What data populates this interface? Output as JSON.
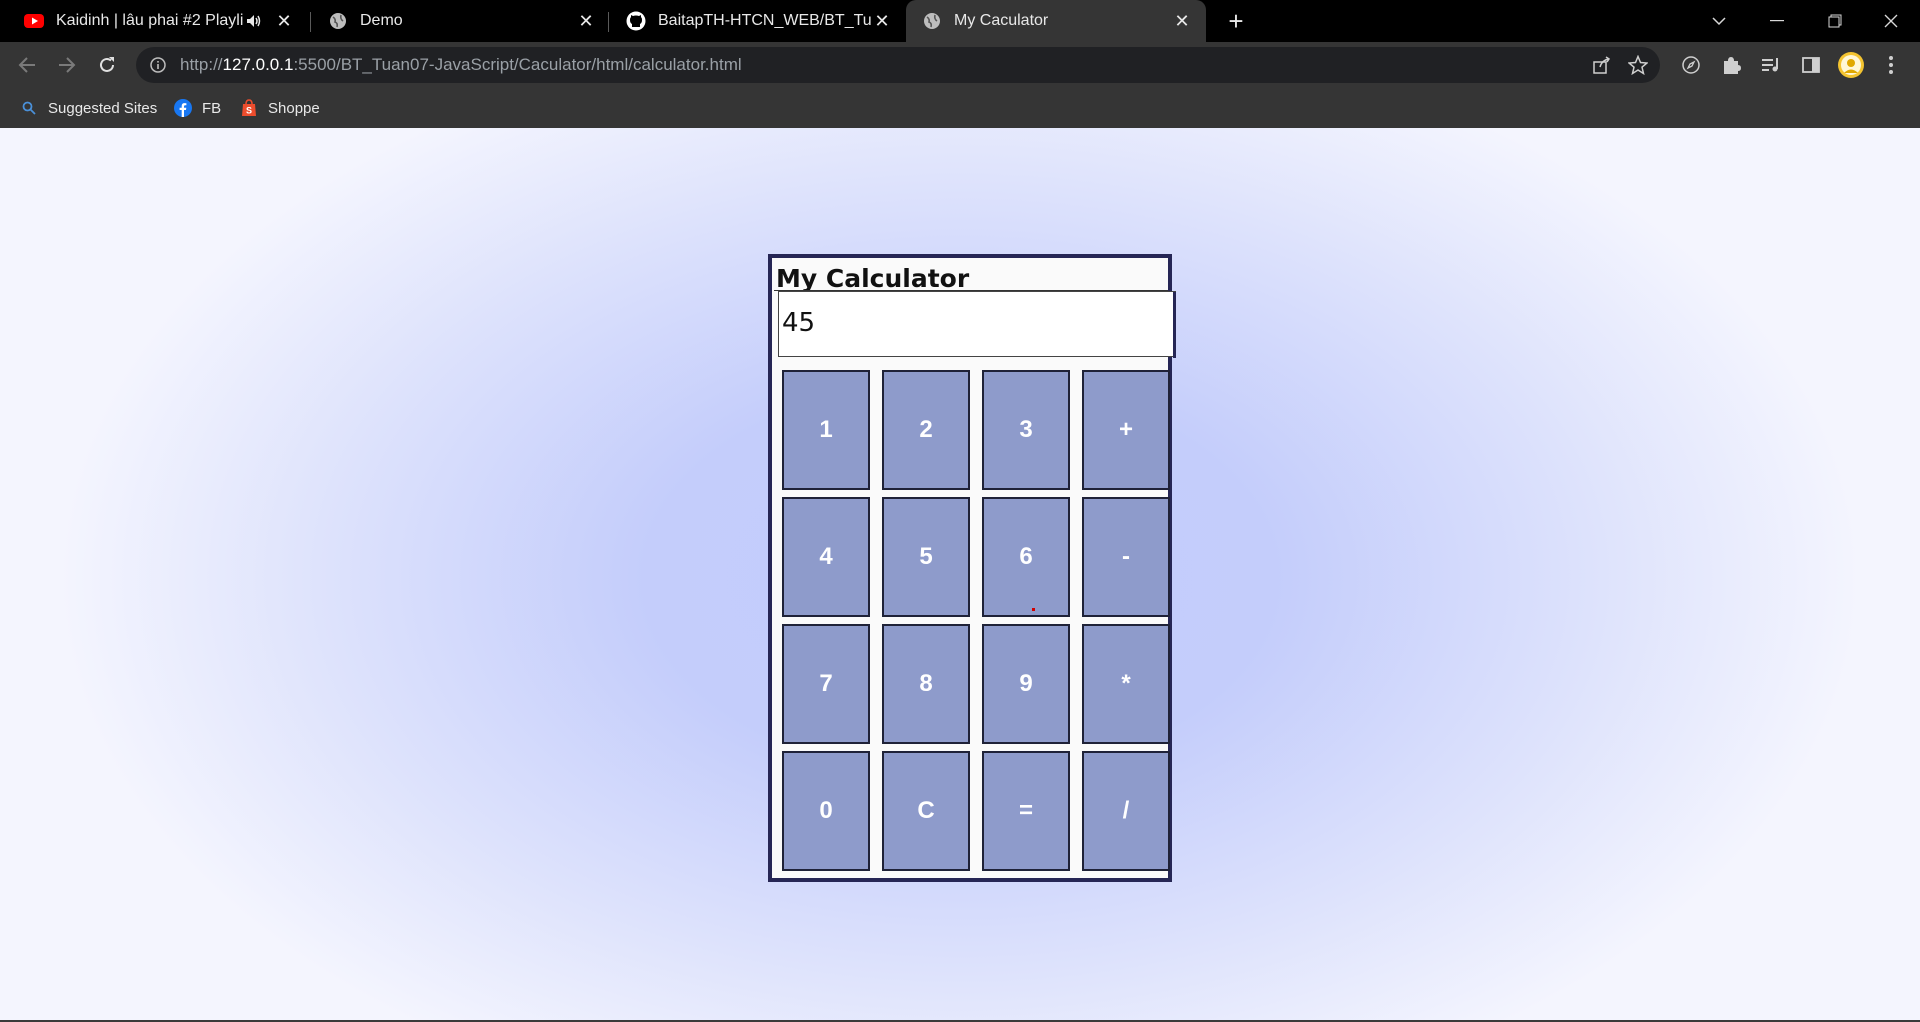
{
  "tabs": [
    {
      "title": "Kaidinh | lâu phai #2 Playlist",
      "icon": "youtube-icon",
      "audio": true
    },
    {
      "title": "Demo",
      "icon": "globe-icon"
    },
    {
      "title": "BaitapTH-HTCN_WEB/BT_Tuan07",
      "icon": "github-icon"
    },
    {
      "title": "My Caculator",
      "icon": "globe-icon",
      "active": true
    }
  ],
  "address": {
    "scheme": "http://",
    "host": "127.0.0.1",
    "rest": ":5500/BT_Tuan07-JavaScript/Caculator/html/calculator.html"
  },
  "bookmarks": [
    {
      "label": "Suggested Sites",
      "icon": "search-icon"
    },
    {
      "label": "FB",
      "icon": "facebook-icon"
    },
    {
      "label": "Shoppe",
      "icon": "shopee-icon"
    }
  ],
  "calculator": {
    "title": "My Calculator",
    "display_value": "45",
    "keys": [
      "1",
      "2",
      "3",
      "+",
      "4",
      "5",
      "6",
      "-",
      "7",
      "8",
      "9",
      "*",
      "0",
      "C",
      "=",
      "/"
    ]
  },
  "colors": {
    "key_fill": "#8e9bcb",
    "frame": "#262655",
    "page_glow": "#c2ccfd"
  }
}
